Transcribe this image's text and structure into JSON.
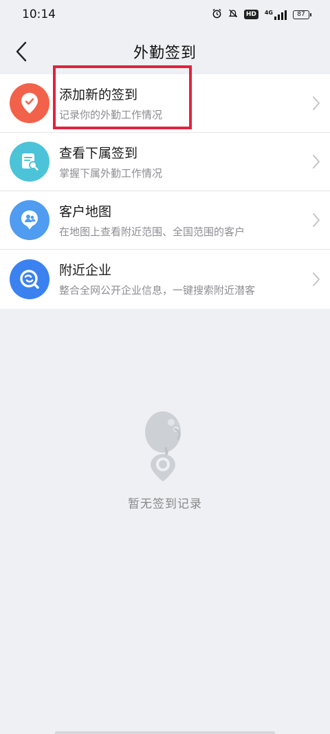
{
  "status_bar": {
    "time": "10:14",
    "icons": [
      "alarm-icon",
      "mute-icon",
      "hd-icon",
      "4g-signal-icon",
      "battery-icon"
    ],
    "hd_label": "HD",
    "network_label": "4G",
    "battery": "87"
  },
  "navbar": {
    "title": "外勤签到",
    "back_icon": "chevron-left-icon"
  },
  "menu": [
    {
      "title": "添加新的签到",
      "subtitle": "记录你的外勤工作情况",
      "icon": "location-check-icon",
      "color": "#f2624a"
    },
    {
      "title": "查看下属签到",
      "subtitle": "掌握下属外勤工作情况",
      "icon": "document-search-icon",
      "color": "#4cc3d9"
    },
    {
      "title": "客户地图",
      "subtitle": "在地图上查看附近范围、全国范围的客户",
      "icon": "customer-map-icon",
      "color": "#4f9cf0"
    },
    {
      "title": "附近企业",
      "subtitle": "整合全网公开企业信息，一键搜索附近潜客",
      "icon": "enterprise-search-icon",
      "color": "#3b82f0"
    }
  ],
  "highlight_color": "#e0233f",
  "empty_state": {
    "icon": "mascot-location-icon",
    "text": "暂无签到记录"
  }
}
